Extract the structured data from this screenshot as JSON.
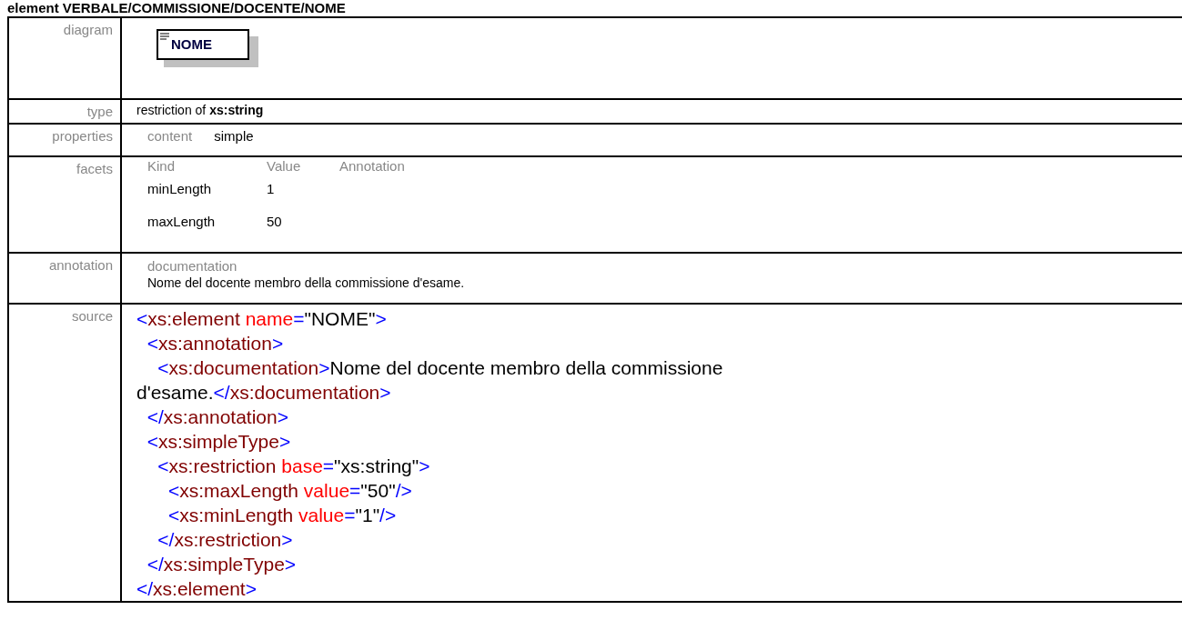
{
  "title": "element VERBALE/COMMISSIONE/DOCENTE/NOME",
  "rows": [
    {
      "kind": "diagram",
      "label": "diagram",
      "element_name": "NOME"
    },
    {
      "kind": "type",
      "label": "type",
      "prefix": "restriction of",
      "base": "xs:string"
    },
    {
      "kind": "properties",
      "label": "properties",
      "items": [
        {
          "name": "content",
          "value": "simple"
        }
      ]
    },
    {
      "kind": "facets",
      "label": "facets",
      "columns": [
        "Kind",
        "Value",
        "Annotation"
      ],
      "items": [
        {
          "kind": "minLength",
          "value": "1"
        },
        {
          "kind": "maxLength",
          "value": "50"
        }
      ]
    },
    {
      "kind": "annotation",
      "label": "annotation",
      "heading": "documentation",
      "text": "Nome del docente membro della commissione d'esame."
    },
    {
      "kind": "source",
      "label": "source",
      "lines": [
        [
          {
            "kind": "mark",
            "text": "<"
          },
          {
            "kind": "tag",
            "text": "xs:element"
          },
          {
            "kind": "attr",
            "text": " name"
          },
          {
            "kind": "mark",
            "text": "="
          },
          {
            "kind": "value",
            "text": "\"NOME\""
          },
          {
            "kind": "mark",
            "text": ">"
          }
        ],
        [
          {
            "kind": "mark",
            "text": "  <"
          },
          {
            "kind": "tag",
            "text": "xs:annotation"
          },
          {
            "kind": "mark",
            "text": ">"
          }
        ],
        [
          {
            "kind": "mark",
            "text": "    <"
          },
          {
            "kind": "tag",
            "text": "xs:documentation"
          },
          {
            "kind": "mark",
            "text": ">"
          },
          {
            "kind": "value",
            "text": "Nome del docente membro della commissione"
          }
        ],
        [
          {
            "kind": "value",
            "text": "d'esame."
          },
          {
            "kind": "mark",
            "text": "</"
          },
          {
            "kind": "tag",
            "text": "xs:documentation"
          },
          {
            "kind": "mark",
            "text": ">"
          }
        ],
        [
          {
            "kind": "mark",
            "text": "  </"
          },
          {
            "kind": "tag",
            "text": "xs:annotation"
          },
          {
            "kind": "mark",
            "text": ">"
          }
        ],
        [
          {
            "kind": "mark",
            "text": "  <"
          },
          {
            "kind": "tag",
            "text": "xs:simpleType"
          },
          {
            "kind": "mark",
            "text": ">"
          }
        ],
        [
          {
            "kind": "mark",
            "text": "    <"
          },
          {
            "kind": "tag",
            "text": "xs:restriction"
          },
          {
            "kind": "attr",
            "text": " base"
          },
          {
            "kind": "mark",
            "text": "="
          },
          {
            "kind": "value",
            "text": "\"xs:string\""
          },
          {
            "kind": "mark",
            "text": ">"
          }
        ],
        [
          {
            "kind": "mark",
            "text": "      <"
          },
          {
            "kind": "tag",
            "text": "xs:maxLength"
          },
          {
            "kind": "attr",
            "text": " value"
          },
          {
            "kind": "mark",
            "text": "="
          },
          {
            "kind": "value",
            "text": "\"50\""
          },
          {
            "kind": "mark",
            "text": "/>"
          }
        ],
        [
          {
            "kind": "mark",
            "text": "      <"
          },
          {
            "kind": "tag",
            "text": "xs:minLength"
          },
          {
            "kind": "attr",
            "text": " value"
          },
          {
            "kind": "mark",
            "text": "="
          },
          {
            "kind": "value",
            "text": "\"1\""
          },
          {
            "kind": "mark",
            "text": "/>"
          }
        ],
        [
          {
            "kind": "mark",
            "text": "    </"
          },
          {
            "kind": "tag",
            "text": "xs:restriction"
          },
          {
            "kind": "mark",
            "text": ">"
          }
        ],
        [
          {
            "kind": "mark",
            "text": "  </"
          },
          {
            "kind": "tag",
            "text": "xs:simpleType"
          },
          {
            "kind": "mark",
            "text": ">"
          }
        ],
        [
          {
            "kind": "mark",
            "text": "</"
          },
          {
            "kind": "tag",
            "text": "xs:element"
          },
          {
            "kind": "mark",
            "text": ">"
          }
        ]
      ]
    }
  ]
}
